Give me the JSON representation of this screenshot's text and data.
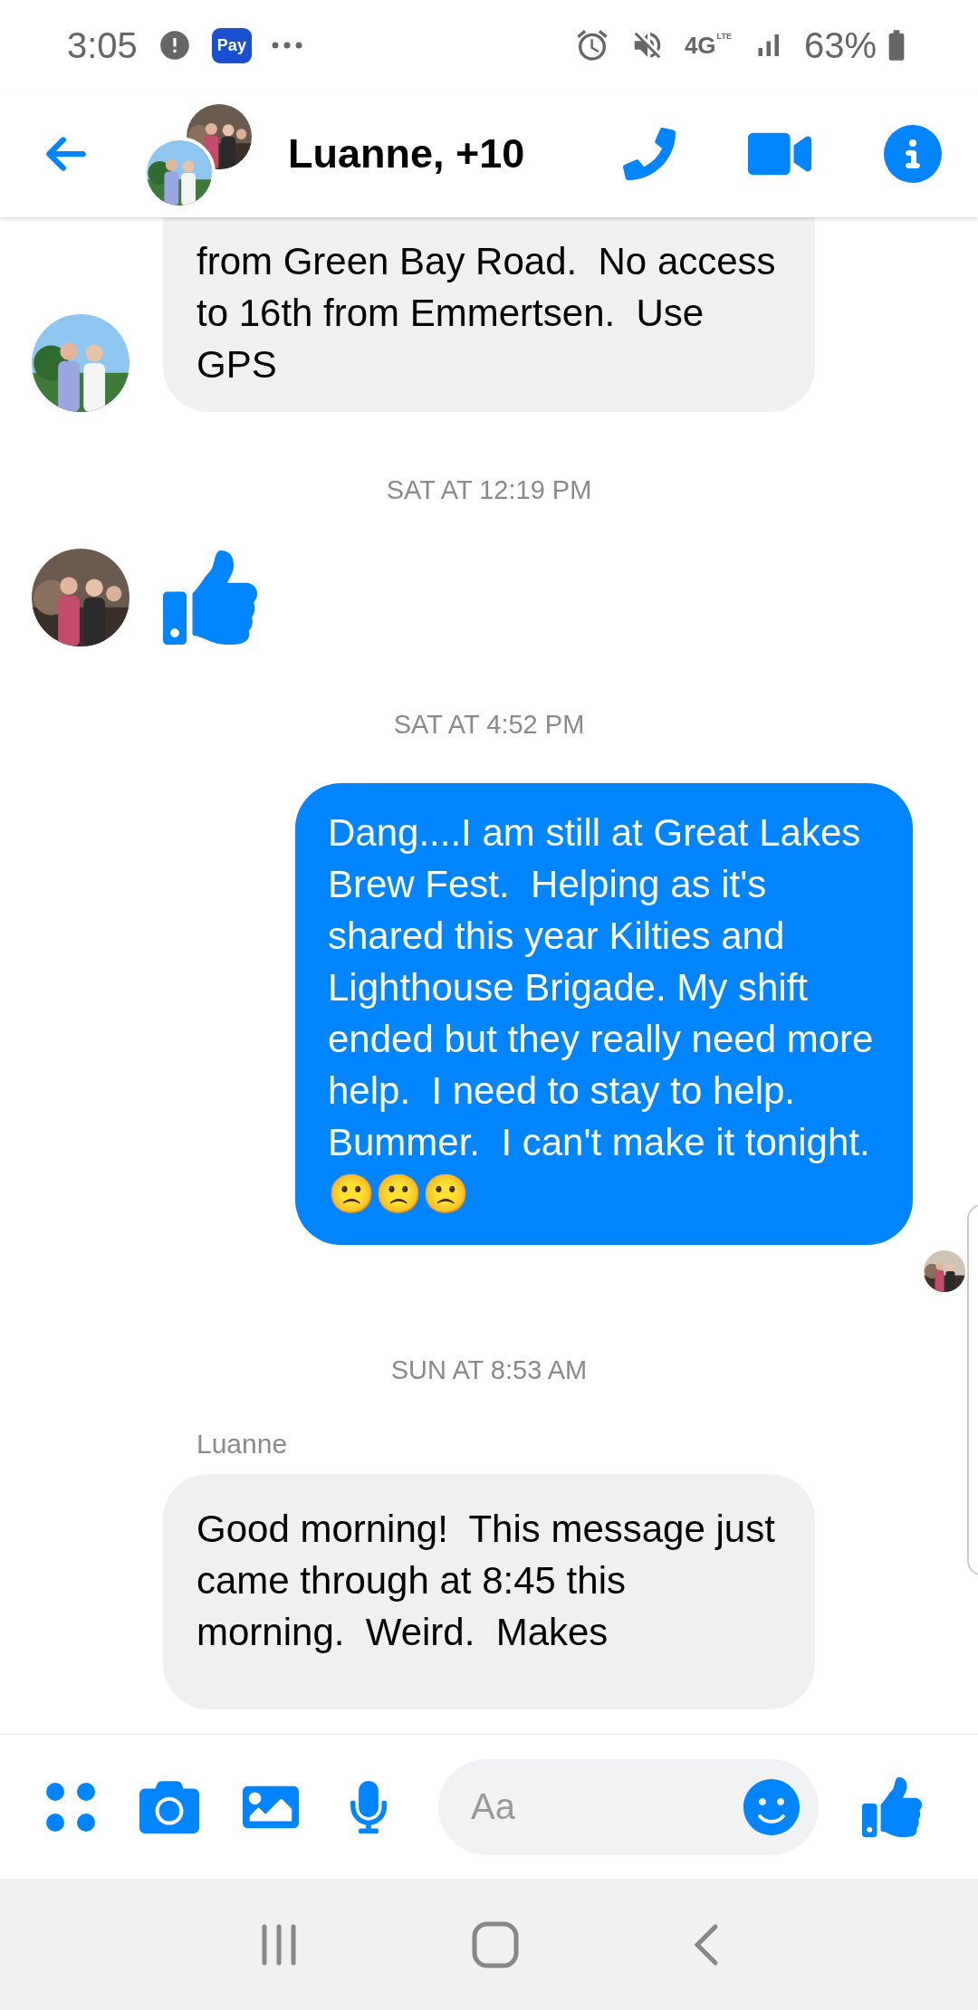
{
  "status_bar": {
    "time": "3:05",
    "pay_label": "Pay",
    "network": "4G",
    "network_sub": "LTE",
    "battery": "63%"
  },
  "header": {
    "title": "Luanne, +10"
  },
  "messages": [
    {
      "kind": "incoming",
      "text": "from Green Bay Road.  No access to 16th from Emmertsen.  Use GPS"
    },
    {
      "kind": "timestamp",
      "text": "SAT AT 12:19 PM"
    },
    {
      "kind": "sticker"
    },
    {
      "kind": "timestamp",
      "text": "SAT AT 4:52 PM"
    },
    {
      "kind": "outgoing",
      "text": "Dang....I am still at Great Lakes Brew Fest.  Helping as it's shared this year Kilties and Lighthouse Brigade. My shift ended but they really need more help.  I need to stay to help. Bummer.  I can't make it tonight.🙁🙁🙁"
    },
    {
      "kind": "read_receipt"
    },
    {
      "kind": "timestamp",
      "text": "SUN AT 8:53 AM"
    },
    {
      "kind": "incoming",
      "sender": "Luanne",
      "text": "Good morning!  This message just came through at 8:45 this morning.  Weird.  Makes"
    }
  ],
  "composer": {
    "placeholder": "Aa"
  }
}
